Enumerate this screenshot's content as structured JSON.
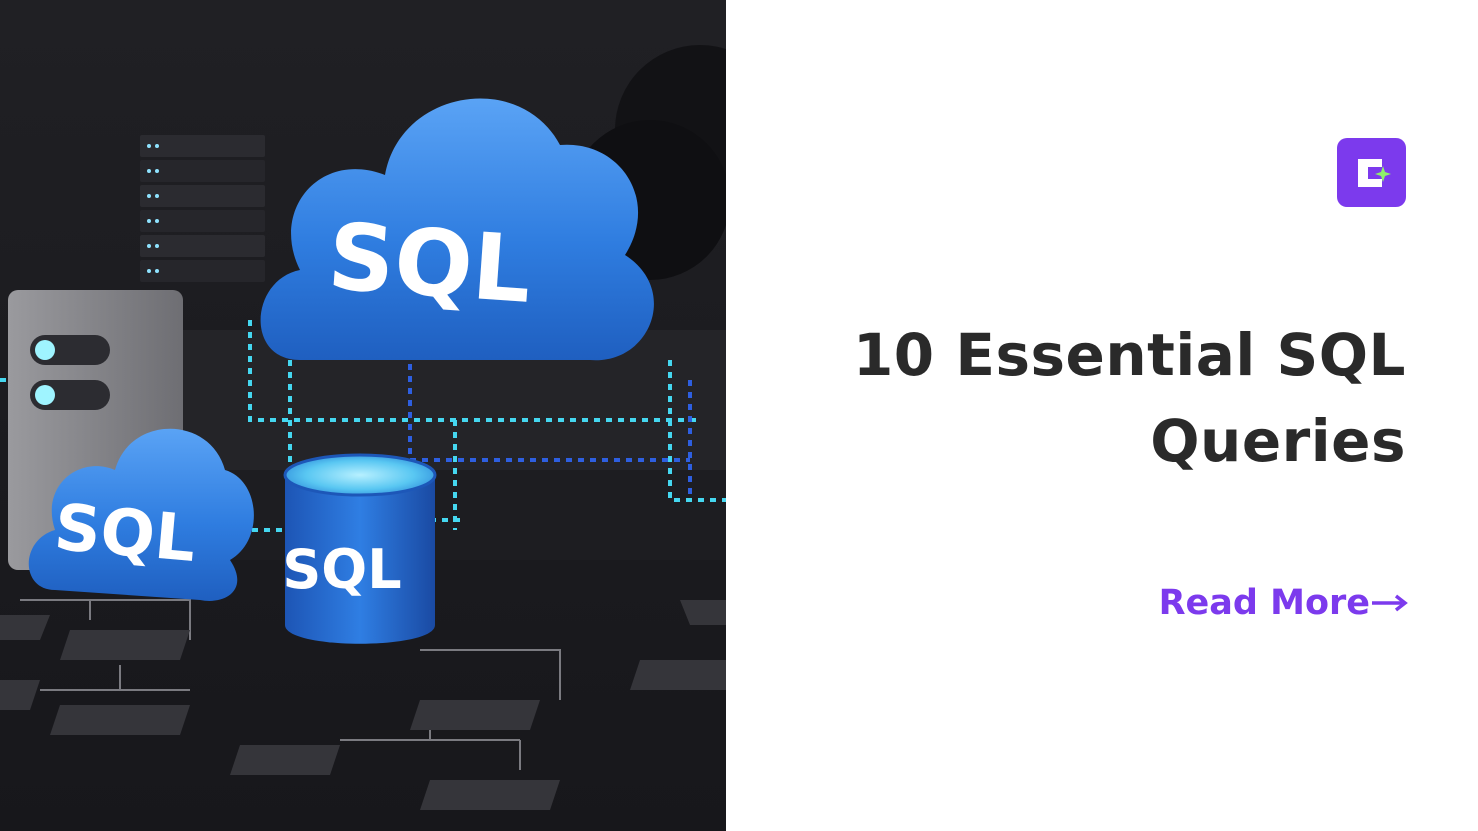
{
  "hero": {
    "badge_texts": [
      "SQL",
      "SQL",
      "SQL"
    ]
  },
  "brand": {
    "logo_icon": "c-sparkle-logo-icon",
    "accent_color": "#7c3aed",
    "sparkle_color": "#8ef06b"
  },
  "article": {
    "title_line1": "10 Essential SQL",
    "title_line2": "Queries",
    "cta_label": "Read More",
    "cta_icon": "arrow-right-icon"
  }
}
